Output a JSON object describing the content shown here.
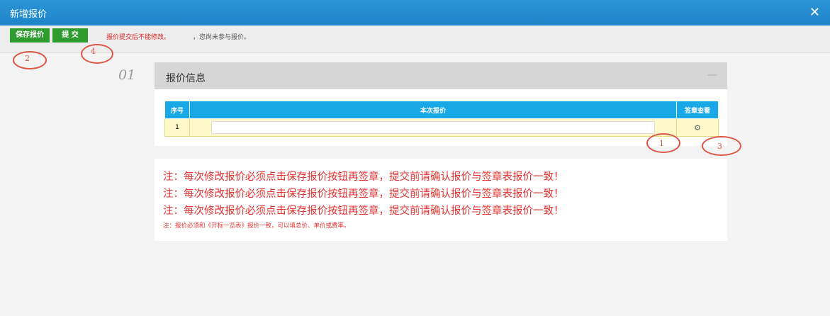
{
  "window": {
    "title": "新增报价",
    "close_icon": "close-icon"
  },
  "toolbar": {
    "save_label": "保存报价",
    "submit_label": "提 交",
    "warning": "报价提交后不能修改。",
    "hint": "，您尚未参与报价。"
  },
  "annotations": [
    "2",
    "4",
    "1",
    "3"
  ],
  "step": {
    "number": "01"
  },
  "panel": {
    "title": "报价信息",
    "collapse_label": "—",
    "table": {
      "headers": [
        "序号",
        "本次报价",
        "签章查看"
      ],
      "rows": [
        {
          "no": "1",
          "price": "",
          "action_icon": "gear-icon"
        }
      ]
    }
  },
  "notes": {
    "lines": [
      "注：每次修改报价必须点击保存报价按钮再签章，提交前请确认报价与签章表报价一致！",
      "注：每次修改报价必须点击保存报价按钮再签章，提交前请确认报价与签章表报价一致！",
      "注：每次修改报价必须点击保存报价按钮再签章，提交前请确认报价与签章表报价一致！"
    ],
    "small": "注：报价必须和《开标一览表》报价一致，可以填总价、单价或费率。"
  },
  "colors": {
    "titlebar": "#2a95d6",
    "button": "#2e9b2e",
    "table_header": "#19a8e8",
    "warning": "#e53030"
  }
}
